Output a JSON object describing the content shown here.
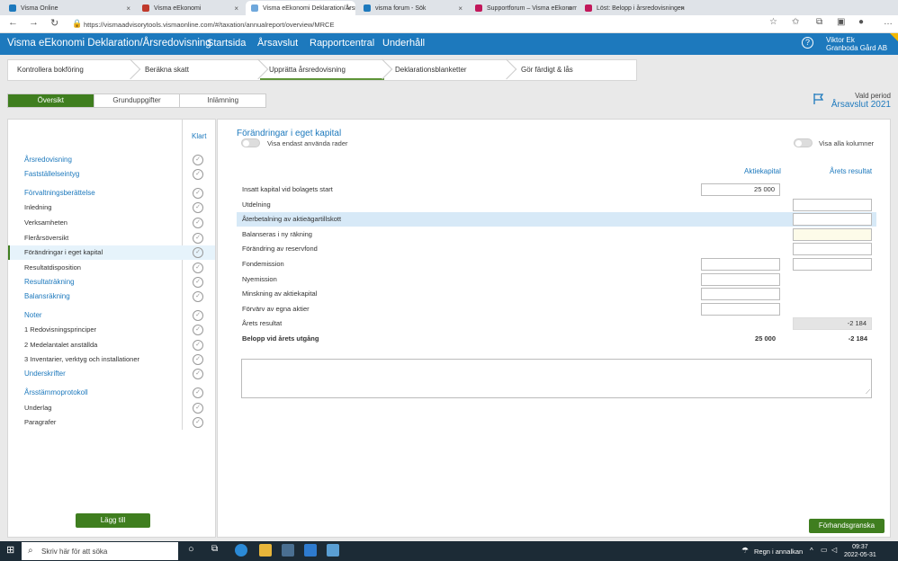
{
  "browser": {
    "tabs": [
      {
        "label": "Visma Online",
        "color": "#1d79bd"
      },
      {
        "label": "Visma eEkonomi",
        "color": "#c0392b"
      },
      {
        "label": "Visma eEkonomi Deklaration/Årsr",
        "color": "#6fa8dc"
      },
      {
        "label": "visma forum - Sök",
        "color": "#1d79bd"
      },
      {
        "label": "Supportforum – Visma eEkonomi",
        "color": "#c2185b"
      },
      {
        "label": "Löst: Belopp i årsredovisningen",
        "color": "#c2185b"
      }
    ],
    "url": "https://vismaadvisorytools.vismaonline.com/#/taxation/annualreport/overview/MRCE"
  },
  "app": {
    "brand": "Visma eEkonomi Deklaration/Årsredovisning",
    "menu": [
      "Startsida",
      "Årsavslut",
      "Rapportcentral",
      "Underhåll"
    ],
    "user_name": "Viktor Ek",
    "company": "Granboda Gård AB",
    "help": "?"
  },
  "steps": [
    "Kontrollera bokföring",
    "Beräkna skatt",
    "Upprätta årsredovisning",
    "Deklarationsblanketter",
    "Gör färdigt & lås"
  ],
  "subtabs": [
    "Översikt",
    "Grunduppgifter",
    "Inlämning"
  ],
  "period": {
    "label": "Vald period",
    "value": "Årsavslut 2021"
  },
  "left": {
    "klart": "Klart",
    "items": [
      {
        "label": "Årsredovisning",
        "heading": true
      },
      {
        "label": "Fastställelseintyg",
        "heading": true
      },
      {
        "label": "Förvaltningsberättelse",
        "heading": true
      },
      {
        "label": "Inledning",
        "heading": false
      },
      {
        "label": "Verksamheten",
        "heading": false
      },
      {
        "label": "Flerårsöversikt",
        "heading": false
      },
      {
        "label": "Förändringar i eget kapital",
        "heading": false,
        "selected": true
      },
      {
        "label": "Resultatdisposition",
        "heading": false
      },
      {
        "label": "Resultaträkning",
        "heading": true
      },
      {
        "label": "Balansräkning",
        "heading": true
      },
      {
        "label": "Noter",
        "heading": true
      },
      {
        "label": "1 Redovisningsprinciper",
        "heading": false
      },
      {
        "label": "2 Medelantalet anställda",
        "heading": false
      },
      {
        "label": "3 Inventarier, verktyg och installationer",
        "heading": false
      },
      {
        "label": "Underskrifter",
        "heading": true
      },
      {
        "label": "Årsstämmoprotokoll",
        "heading": true
      },
      {
        "label": "Underlag",
        "heading": false
      },
      {
        "label": "Paragrafer",
        "heading": false
      }
    ],
    "add_button": "Lägg till"
  },
  "main": {
    "title": "Förändringar i eget kapital",
    "toggle_used": "Visa endast använda rader",
    "toggle_all": "Visa alla kolumner",
    "col_aktiekapital": "Aktiekapital",
    "col_arets": "Årets resultat",
    "rows": [
      {
        "label": "Insatt kapital vid bolagets start",
        "a": "25 000",
        "r": null
      },
      {
        "label": "Utdelning",
        "a": null,
        "r": ""
      },
      {
        "label": "Återbetalning av aktieägartillskott",
        "a": null,
        "r": ""
      },
      {
        "label": "Balanseras i ny räkning",
        "a": null,
        "r": ""
      },
      {
        "label": "Förändring av reservfond",
        "a": null,
        "r": ""
      },
      {
        "label": "Fondemission",
        "a": "",
        "r": ""
      },
      {
        "label": "Nyemission",
        "a": "",
        "r": null
      },
      {
        "label": "Minskning av aktiekapital",
        "a": "",
        "r": null
      },
      {
        "label": "Förvärv av egna aktier",
        "a": "",
        "r": null
      },
      {
        "label": "Årets resultat",
        "a": null,
        "r": "-2 184"
      }
    ],
    "total_label": "Belopp vid årets utgång",
    "total_a": "25 000",
    "total_r": "-2 184",
    "preview_button": "Förhandsgranska"
  },
  "taskbar": {
    "search_placeholder": "Skriv här för att söka",
    "weather": "Regn i annalkan",
    "time": "09:37",
    "date": "2022-05-31"
  }
}
